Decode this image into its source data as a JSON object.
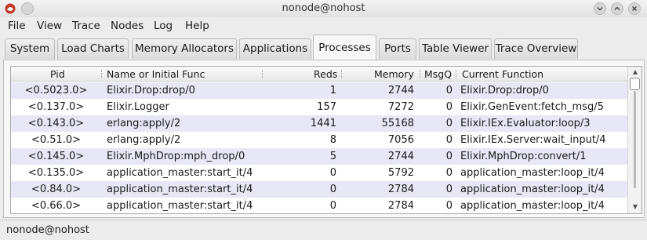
{
  "window": {
    "title": "nonode@nohost"
  },
  "menubar": {
    "items": [
      "File",
      "View",
      "Trace",
      "Nodes",
      "Log",
      "Help"
    ]
  },
  "tabs": [
    "System",
    "Load Charts",
    "Memory Allocators",
    "Applications",
    "Processes",
    "Ports",
    "Table Viewer",
    "Trace Overview"
  ],
  "active_tab": "Processes",
  "table": {
    "columns": [
      "Pid",
      "Name or Initial Func",
      "Reds",
      "Memory",
      "MsgQ",
      "Current Function"
    ],
    "rows": [
      [
        "<0.5023.0>",
        "Elixir.Drop:drop/0",
        "1",
        "2744",
        "0",
        "Elixir.Drop:drop/0"
      ],
      [
        "<0.137.0>",
        "Elixir.Logger",
        "157",
        "7272",
        "0",
        "Elixir.GenEvent:fetch_msg/5"
      ],
      [
        "<0.143.0>",
        "erlang:apply/2",
        "1441",
        "55168",
        "0",
        "Elixir.IEx.Evaluator:loop/3"
      ],
      [
        "<0.51.0>",
        "erlang:apply/2",
        "8",
        "7056",
        "0",
        "Elixir.IEx.Server:wait_input/4"
      ],
      [
        "<0.145.0>",
        "Elixir.MphDrop:mph_drop/0",
        "5",
        "2744",
        "0",
        "Elixir.MphDrop:convert/1"
      ],
      [
        "<0.135.0>",
        "application_master:start_it/4",
        "0",
        "5792",
        "0",
        "application_master:loop_it/4"
      ],
      [
        "<0.84.0>",
        "application_master:start_it/4",
        "0",
        "2784",
        "0",
        "application_master:loop_it/4"
      ],
      [
        "<0.66.0>",
        "application_master:start_it/4",
        "0",
        "2784",
        "0",
        "application_master:loop_it/4"
      ]
    ]
  },
  "statusbar": {
    "text": "nonode@nohost"
  },
  "colors": {
    "row_alt": "#e7e7f5",
    "background": "#ececec"
  }
}
